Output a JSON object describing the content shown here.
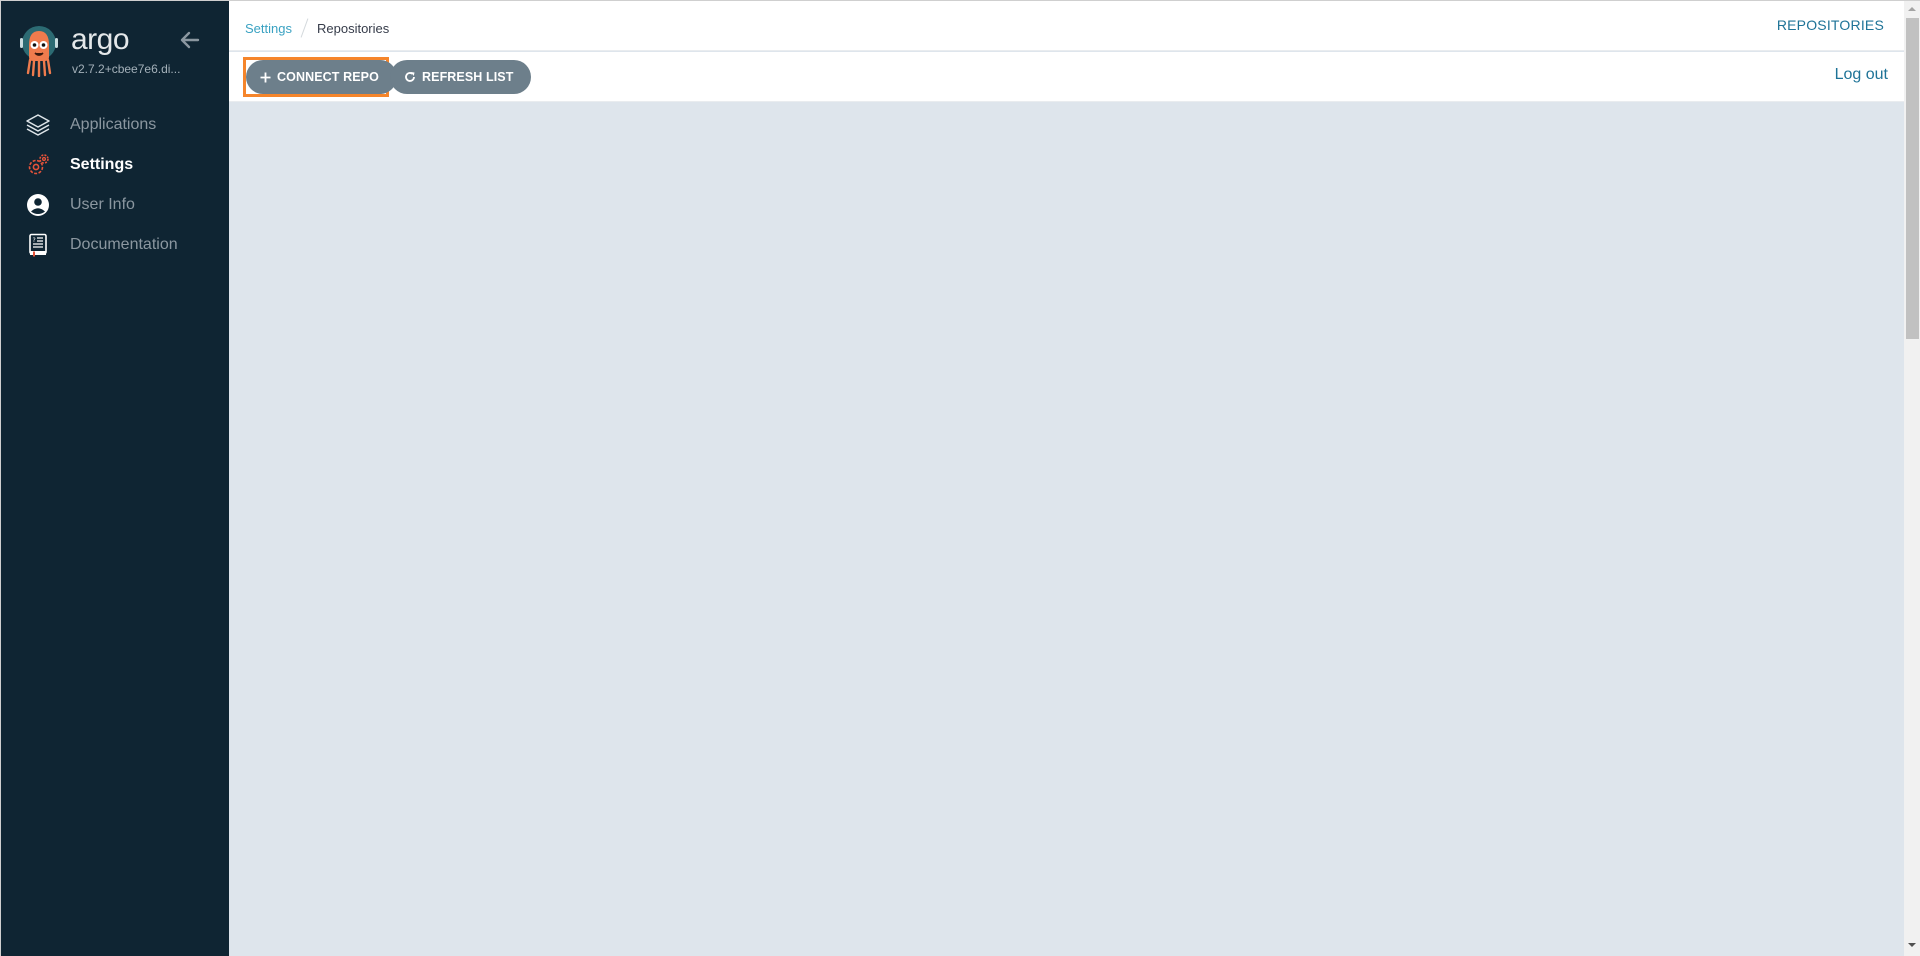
{
  "sidebar": {
    "brand": "argo",
    "version": "v2.7.2+cbee7e6.di...",
    "items": [
      {
        "label": "Applications",
        "icon": "layers-icon",
        "active": false
      },
      {
        "label": "Settings",
        "icon": "gears-icon",
        "active": true
      },
      {
        "label": "User Info",
        "icon": "user-circle-icon",
        "active": false
      },
      {
        "label": "Documentation",
        "icon": "book-icon",
        "active": false
      }
    ]
  },
  "header": {
    "breadcrumbs": [
      {
        "label": "Settings"
      },
      {
        "label": "Repositories"
      }
    ],
    "page_title": "REPOSITORIES"
  },
  "toolbar": {
    "connect_label": "CONNECT REPO",
    "refresh_label": "REFRESH LIST",
    "logout_label": "Log out"
  },
  "colors": {
    "sidebar_bg": "#0f2533",
    "accent": "#1e7397",
    "link": "#3aa2c2",
    "button_bg": "#6d7f8b",
    "focus": "#f5852b",
    "active_icon": "#e5533a",
    "content_bg": "#dee5ec"
  }
}
